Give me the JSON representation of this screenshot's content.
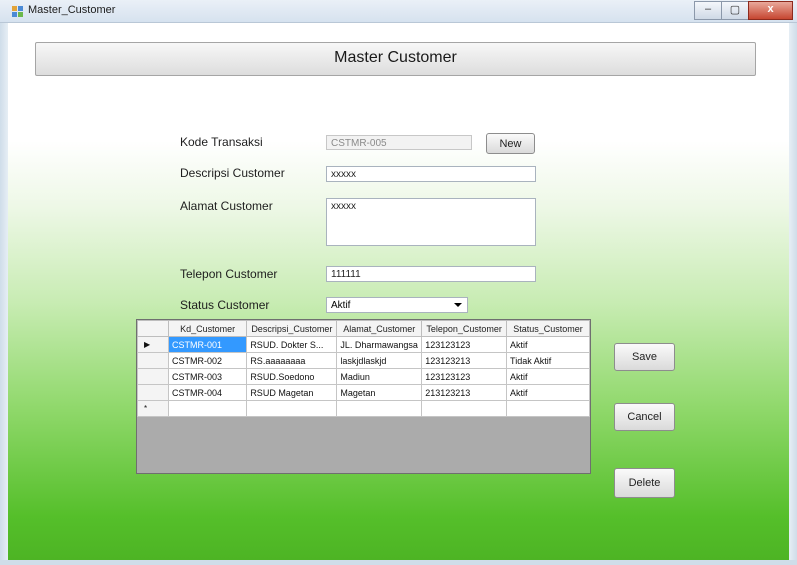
{
  "window": {
    "title": "Master_Customer",
    "controls": [
      "–",
      "▢",
      "x"
    ]
  },
  "header": {
    "title": "Master Customer"
  },
  "form": {
    "kode_label": "Kode Transaksi",
    "kode_value": "CSTMR-005",
    "new_button": "New",
    "deskripsi_label": "Descripsi Customer",
    "deskripsi_value": "xxxxx",
    "alamat_label": "Alamat Customer",
    "alamat_value": "xxxxx",
    "telepon_label": "Telepon Customer",
    "telepon_value": "111111",
    "status_label": "Status Customer",
    "status_value": "Aktif"
  },
  "grid": {
    "columns": [
      "Kd_Customer",
      "Descripsi_Customer",
      "Alamat_Customer",
      "Telepon_Customer",
      "Status_Customer"
    ],
    "rows": [
      [
        "CSTMR-001",
        "RSUD. Dokter S...",
        "JL. Dharmawangsa",
        "123123123",
        "Aktif"
      ],
      [
        "CSTMR-002",
        "RS.aaaaaaaa",
        "laskjdlaskjd",
        "123123213",
        "Tidak Aktif"
      ],
      [
        "CSTMR-003",
        "RSUD.Soedono",
        "Madiun",
        "123123123",
        "Aktif"
      ],
      [
        "CSTMR-004",
        "RSUD Magetan",
        "Magetan",
        "213123213",
        "Aktif"
      ]
    ],
    "current_marker": "▶",
    "new_row_marker": "*"
  },
  "buttons": {
    "save": "Save",
    "cancel": "Cancel",
    "delete": "Delete"
  }
}
